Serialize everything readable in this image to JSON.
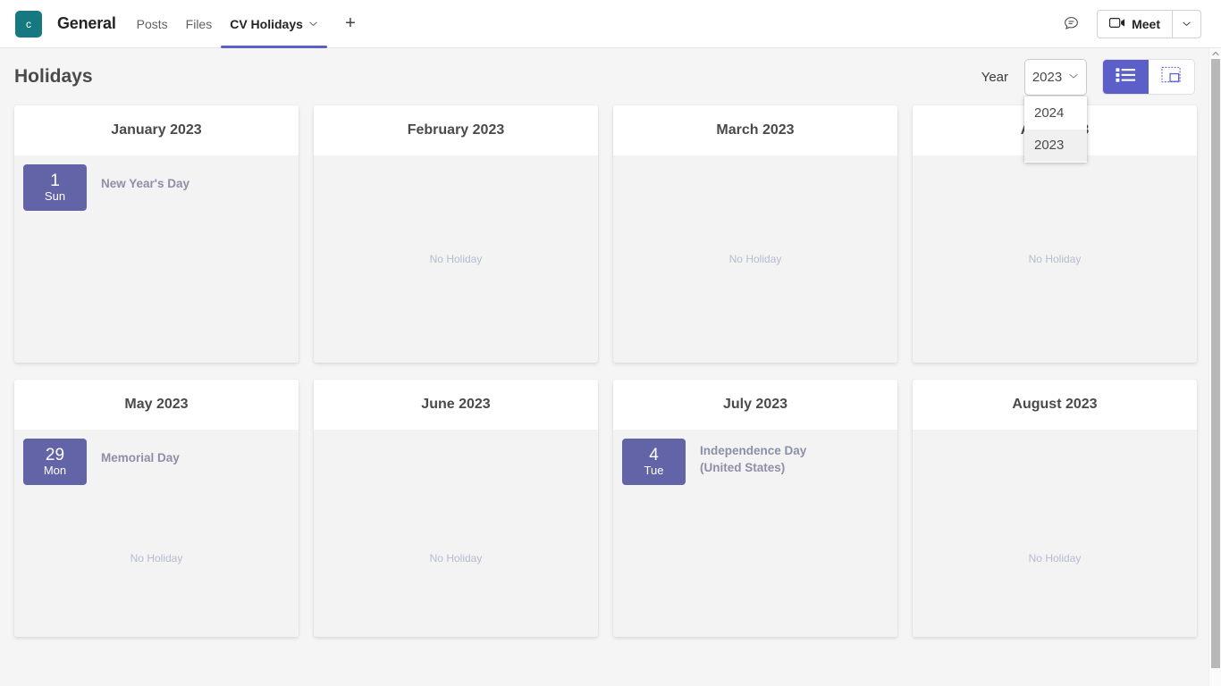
{
  "topbar": {
    "avatar_letter": "c",
    "channel": "General",
    "tabs": [
      {
        "label": "Posts",
        "active": false,
        "has_caret": false
      },
      {
        "label": "Files",
        "active": false,
        "has_caret": false
      },
      {
        "label": "CV Holidays",
        "active": true,
        "has_caret": true
      }
    ],
    "add_tab_label": "+",
    "feedback_icon": "chat-bubble-icon",
    "meet_label": "Meet",
    "meet_icon": "video-camera-icon",
    "meet_caret_icon": "chevron-down-icon"
  },
  "header": {
    "title": "Holidays",
    "year_label": "Year",
    "year_selected": "2023",
    "year_caret_icon": "chevron-down-icon",
    "year_options": [
      {
        "label": "2024",
        "selected": false
      },
      {
        "label": "2023",
        "selected": true
      }
    ],
    "views": [
      {
        "name": "list-view",
        "icon": "list-view-icon",
        "active": true
      },
      {
        "name": "grid-view",
        "icon": "grid-view-icon",
        "active": false
      }
    ]
  },
  "empty_text": "No Holiday",
  "months": [
    {
      "title": "January 2023",
      "holidays": [
        {
          "day": "1",
          "weekday": "Sun",
          "name": "New Year's Day"
        }
      ]
    },
    {
      "title": "February 2023",
      "holidays": []
    },
    {
      "title": "March 2023",
      "holidays": []
    },
    {
      "title": "April 2023",
      "holidays": []
    },
    {
      "title": "May 2023",
      "holidays": [
        {
          "day": "29",
          "weekday": "Mon",
          "name": "Memorial Day"
        }
      ]
    },
    {
      "title": "June 2023",
      "holidays": []
    },
    {
      "title": "July 2023",
      "holidays": [
        {
          "day": "4",
          "weekday": "Tue",
          "name": "Independence Day (United States)"
        }
      ]
    },
    {
      "title": "August 2023",
      "holidays": []
    }
  ],
  "colors": {
    "accent": "#5b5fc7",
    "badge": "#6264a7",
    "team_avatar": "#15797f",
    "holiday_text": "#8d8fa8",
    "empty_text": "#b5bcd0"
  }
}
